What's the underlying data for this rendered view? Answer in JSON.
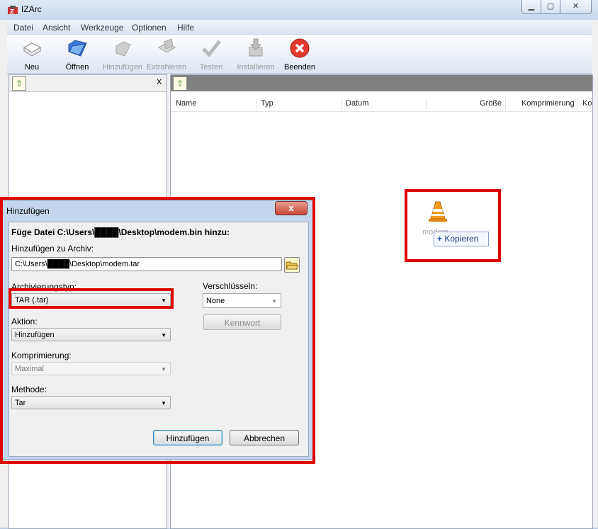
{
  "window": {
    "title": "IZArc",
    "min_glyph": "▁",
    "max_glyph": "▢",
    "close_glyph": "✕"
  },
  "menu": [
    "Datei",
    "Ansicht",
    "Werkzeuge",
    "Optionen",
    "Hilfe"
  ],
  "toolbar": [
    {
      "label": "Neu",
      "icon": "new-archive-icon",
      "enabled": true
    },
    {
      "label": "Öffnen",
      "icon": "open-folder-icon",
      "enabled": true
    },
    {
      "label": "Hinzufügen",
      "icon": "add-files-icon",
      "enabled": false
    },
    {
      "label": "Extrahieren",
      "icon": "extract-icon",
      "enabled": false
    },
    {
      "label": "Testen",
      "icon": "test-checkmark-icon",
      "enabled": false
    },
    {
      "label": "Installieren",
      "icon": "install-icon",
      "enabled": false
    },
    {
      "label": "Beenden",
      "icon": "exit-icon",
      "enabled": true
    }
  ],
  "left_pane": {
    "close_label": "X"
  },
  "file_list": {
    "columns": [
      "Name",
      "Typ",
      "Datum",
      "Größe",
      "Komprimierung",
      "Ko"
    ]
  },
  "drag": {
    "file_name": "modem",
    "tooltip": "Kopieren",
    "tooltip_plus": "+"
  },
  "dialog": {
    "title": "Hinzufügen",
    "close_glyph": "x",
    "heading": "Füge Datei C:\\Users\\████\\Desktop\\modem.bin hinzu:",
    "archive_label": "Hinzufügen zu Archiv:",
    "archive_value": "C:\\Users\\████\\Desktop\\modem.tar",
    "archtype_label": "Archivierungstyp:",
    "archtype_value": "TAR (.tar)",
    "action_label": "Aktion:",
    "action_value": "Hinzufügen",
    "compression_label": "Komprimierung:",
    "compression_value": "Maximal",
    "method_label": "Methode:",
    "method_value": "Tar",
    "encrypt_label": "Verschlüsseln:",
    "encrypt_value": "None",
    "password_button": "Kennwort",
    "ok_button": "Hinzufügen",
    "cancel_button": "Abbrechen"
  },
  "colors": {
    "highlight_red": "#e00000"
  }
}
